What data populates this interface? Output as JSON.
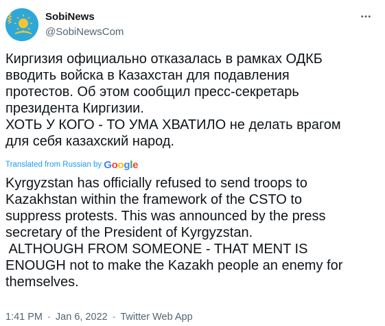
{
  "tweet": {
    "display_name": "SobiNews",
    "handle": "@SobiNewsCom",
    "more_icon": "more-horizontal-icon",
    "avatar_colors": {
      "sky": "#2ea8d8",
      "sun": "#f4c533"
    },
    "text_ru_lines": [
      "Киргизия официально отказалась в рамках ОДКБ",
      "вводить войска в Казахстан для подавления",
      "протестов. Об этом сообщил пресс-секретарь",
      "президента Киргизии.",
      "ХОТЬ У КОГО - ТО УМА ХВАТИЛО не делать врагом",
      "для себя казахский народ."
    ],
    "translated_label": "Translated from Russian by",
    "google": [
      "G",
      "o",
      "o",
      "g",
      "l",
      "e"
    ],
    "text_en_lines": [
      "Kyrgyzstan has officially refused to send troops to",
      "Kazakhstan within the framework of the CSTO to",
      "suppress protests. This was announced by the press",
      "secretary of the President of Kyrgyzstan.",
      " ALTHOUGH FROM SOMEONE - THAT MENT IS",
      "ENOUGH not to make the Kazakh people an enemy for",
      "themselves."
    ],
    "time": "1:41 PM",
    "date": "Jan 6, 2022",
    "source": "Twitter Web App",
    "separator": "·"
  }
}
